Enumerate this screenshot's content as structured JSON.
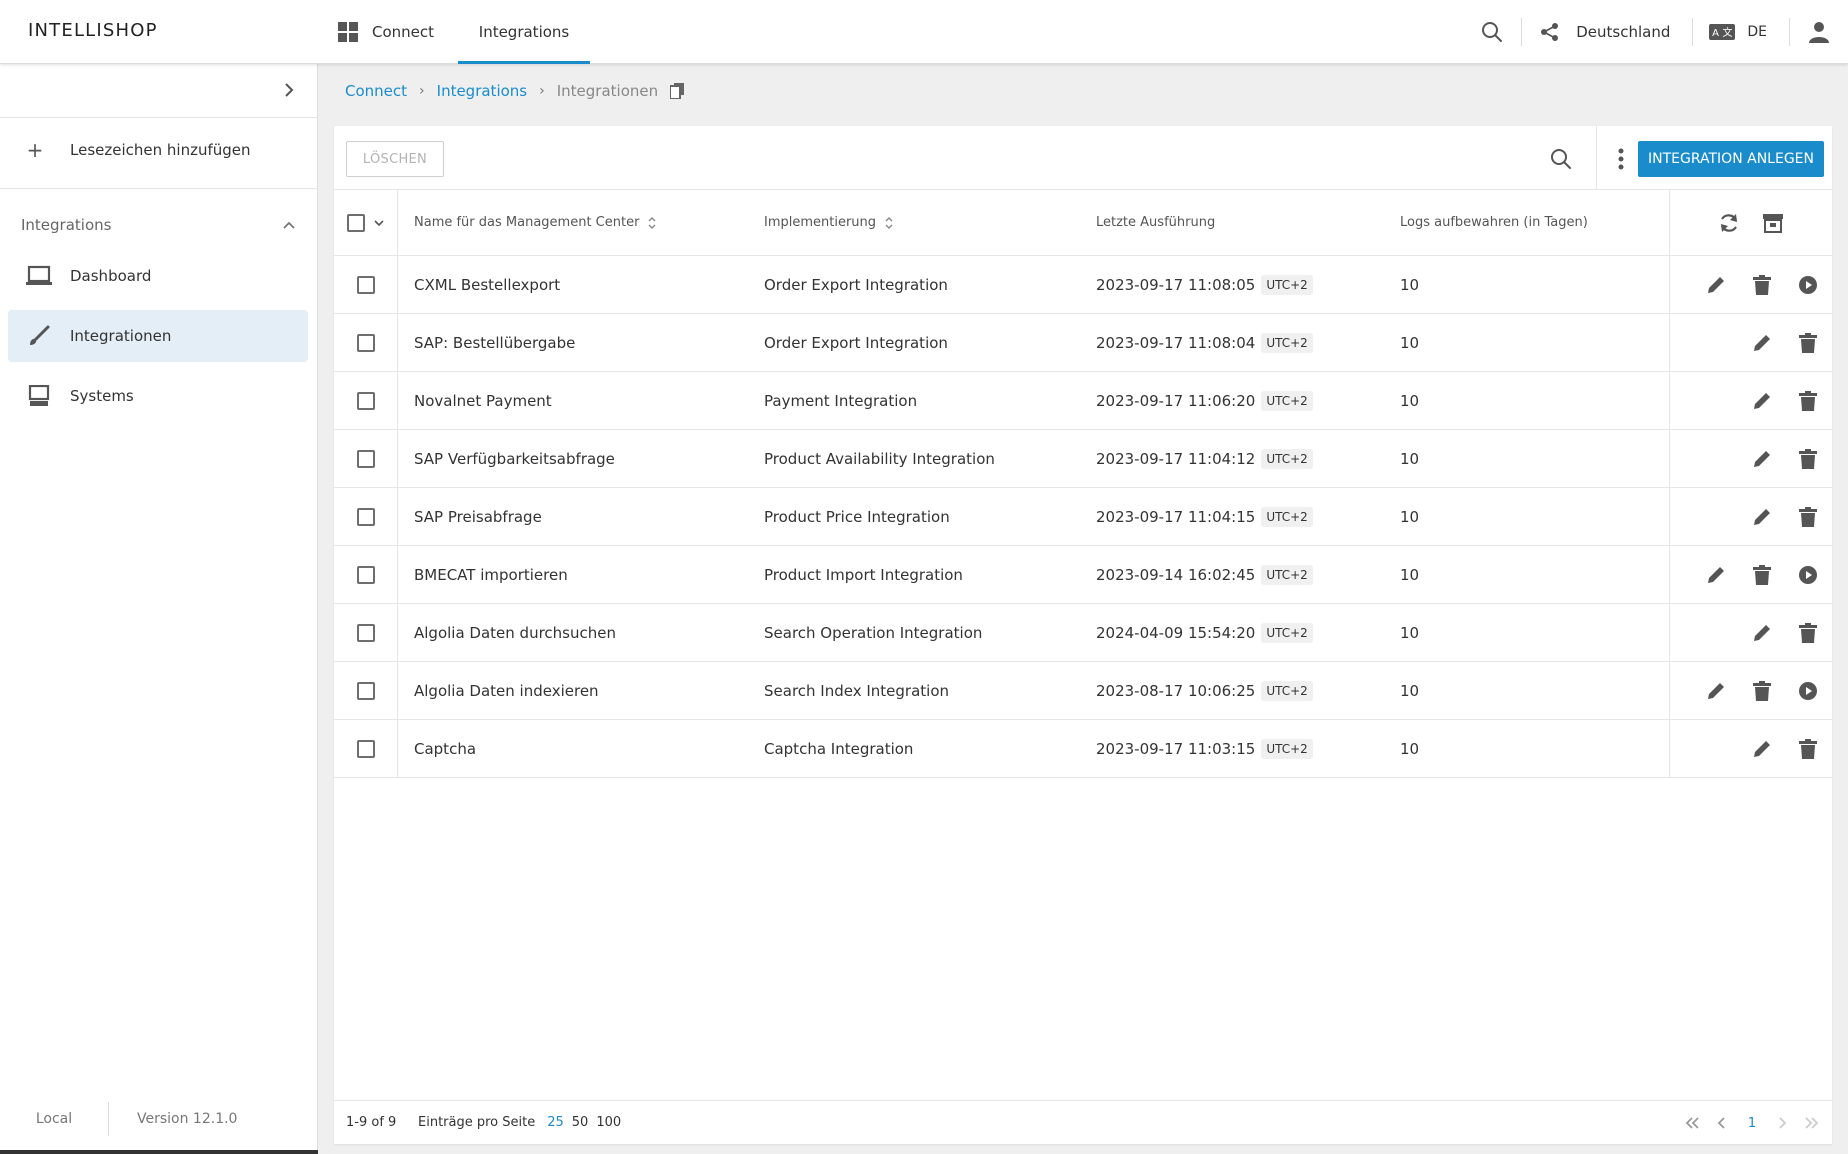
{
  "header": {
    "logo": "INTELLISHOP",
    "nav": [
      {
        "label": "Connect"
      },
      {
        "label": "Integrations"
      }
    ],
    "country": "Deutschland",
    "language": "DE"
  },
  "sidebar": {
    "bookmark_label": "Lesezeichen hinzufügen",
    "section_label": "Integrations",
    "items": [
      {
        "label": "Dashboard",
        "icon": "laptop-icon"
      },
      {
        "label": "Integrationen",
        "icon": "brush-icon",
        "active": true
      },
      {
        "label": "Systems",
        "icon": "computer-icon"
      }
    ],
    "environment": "Local",
    "version": "Version 12.1.0"
  },
  "breadcrumb": {
    "items": [
      "Connect",
      "Integrations"
    ],
    "current": "Integrationen"
  },
  "toolbar": {
    "delete_label": "LÖSCHEN",
    "create_label": "INTEGRATION ANLEGEN"
  },
  "table": {
    "columns": {
      "name": "Name für das Management Center",
      "impl": "Implementierung",
      "last": "Letzte Ausführung",
      "logs": "Logs aufbewahren (in Tagen)"
    },
    "rows": [
      {
        "name": "CXML Bestellexport",
        "impl": "Order Export Integration",
        "last": "2023-09-17 11:08:05",
        "tz": "UTC+2",
        "logs": "10",
        "run": true
      },
      {
        "name": "SAP: Bestellübergabe",
        "impl": "Order Export Integration",
        "last": "2023-09-17 11:08:04",
        "tz": "UTC+2",
        "logs": "10",
        "run": false
      },
      {
        "name": "Novalnet Payment",
        "impl": "Payment Integration",
        "last": "2023-09-17 11:06:20",
        "tz": "UTC+2",
        "logs": "10",
        "run": false
      },
      {
        "name": "SAP Verfügbarkeitsabfrage",
        "impl": "Product Availability Integration",
        "last": "2023-09-17 11:04:12",
        "tz": "UTC+2",
        "logs": "10",
        "run": false
      },
      {
        "name": "SAP Preisabfrage",
        "impl": "Product Price Integration",
        "last": "2023-09-17 11:04:15",
        "tz": "UTC+2",
        "logs": "10",
        "run": false
      },
      {
        "name": "BMECAT importieren",
        "impl": "Product Import Integration",
        "last": "2023-09-14 16:02:45",
        "tz": "UTC+2",
        "logs": "10",
        "run": true
      },
      {
        "name": "Algolia Daten durchsuchen",
        "impl": "Search Operation Integration",
        "last": "2024-04-09 15:54:20",
        "tz": "UTC+2",
        "logs": "10",
        "run": false
      },
      {
        "name": "Algolia Daten indexieren",
        "impl": "Search Index Integration",
        "last": "2023-08-17 10:06:25",
        "tz": "UTC+2",
        "logs": "10",
        "run": true
      },
      {
        "name": "Captcha",
        "impl": "Captcha Integration",
        "last": "2023-09-17 11:03:15",
        "tz": "UTC+2",
        "logs": "10",
        "run": false
      }
    ]
  },
  "footer": {
    "range": "1-9 of 9",
    "per_page_label": "Einträge pro Seite",
    "per_page_options": [
      "25",
      "50",
      "100"
    ],
    "page": "1"
  },
  "colors": {
    "accent": "#1a8ccb",
    "active_bg": "#e3eef6"
  }
}
